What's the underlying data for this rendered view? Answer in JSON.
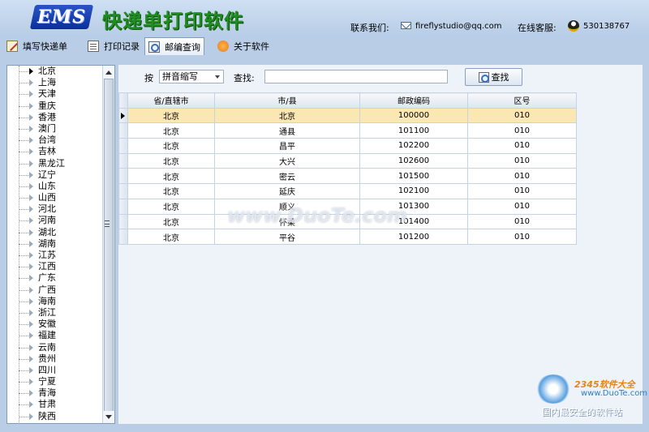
{
  "header": {
    "logo_text": "EMS",
    "app_title": "快递单打印软件",
    "contact_label": "联系我们:",
    "contact_email": "fireflystudio@qq.com",
    "service_label": "在线客服:",
    "qq_number": "530138767"
  },
  "tabs": [
    {
      "label": "填写快递单",
      "icon": "form-icon",
      "active": false
    },
    {
      "label": "打印记录",
      "icon": "print-record-icon",
      "active": false
    },
    {
      "label": "邮编查询",
      "icon": "search-icon",
      "active": true
    },
    {
      "label": "关于软件",
      "icon": "about-icon",
      "active": false
    }
  ],
  "tree": {
    "selected": "北京",
    "items": [
      "北京",
      "上海",
      "天津",
      "重庆",
      "香港",
      "澳门",
      "台湾",
      "吉林",
      "黑龙江",
      "辽宁",
      "山东",
      "山西",
      "河北",
      "河南",
      "湖北",
      "湖南",
      "江苏",
      "江西",
      "广东",
      "广西",
      "海南",
      "浙江",
      "安徽",
      "福建",
      "云南",
      "贵州",
      "四川",
      "宁夏",
      "青海",
      "甘肃",
      "陕西"
    ]
  },
  "search": {
    "by_label": "按",
    "mode_value": "拼音缩写",
    "query_label": "查找:",
    "query_value": "",
    "button_label": "查找"
  },
  "table": {
    "columns": [
      "省/直辖市",
      "市/县",
      "邮政编码",
      "区号"
    ],
    "rows": [
      [
        "北京",
        "北京",
        "100000",
        "010"
      ],
      [
        "北京",
        "通县",
        "101100",
        "010"
      ],
      [
        "北京",
        "昌平",
        "102200",
        "010"
      ],
      [
        "北京",
        "大兴",
        "102600",
        "010"
      ],
      [
        "北京",
        "密云",
        "101500",
        "010"
      ],
      [
        "北京",
        "延庆",
        "102100",
        "010"
      ],
      [
        "北京",
        "顺义",
        "101300",
        "010"
      ],
      [
        "北京",
        "怀柔",
        "101400",
        "010"
      ],
      [
        "北京",
        "平谷",
        "101200",
        "010"
      ]
    ],
    "selected_row": 0
  },
  "watermark": "www.DuoTe.com",
  "brand": {
    "name": "2345软件大全",
    "url": "www.DuoTe.com",
    "slogan": "国内最安全的软件站"
  }
}
